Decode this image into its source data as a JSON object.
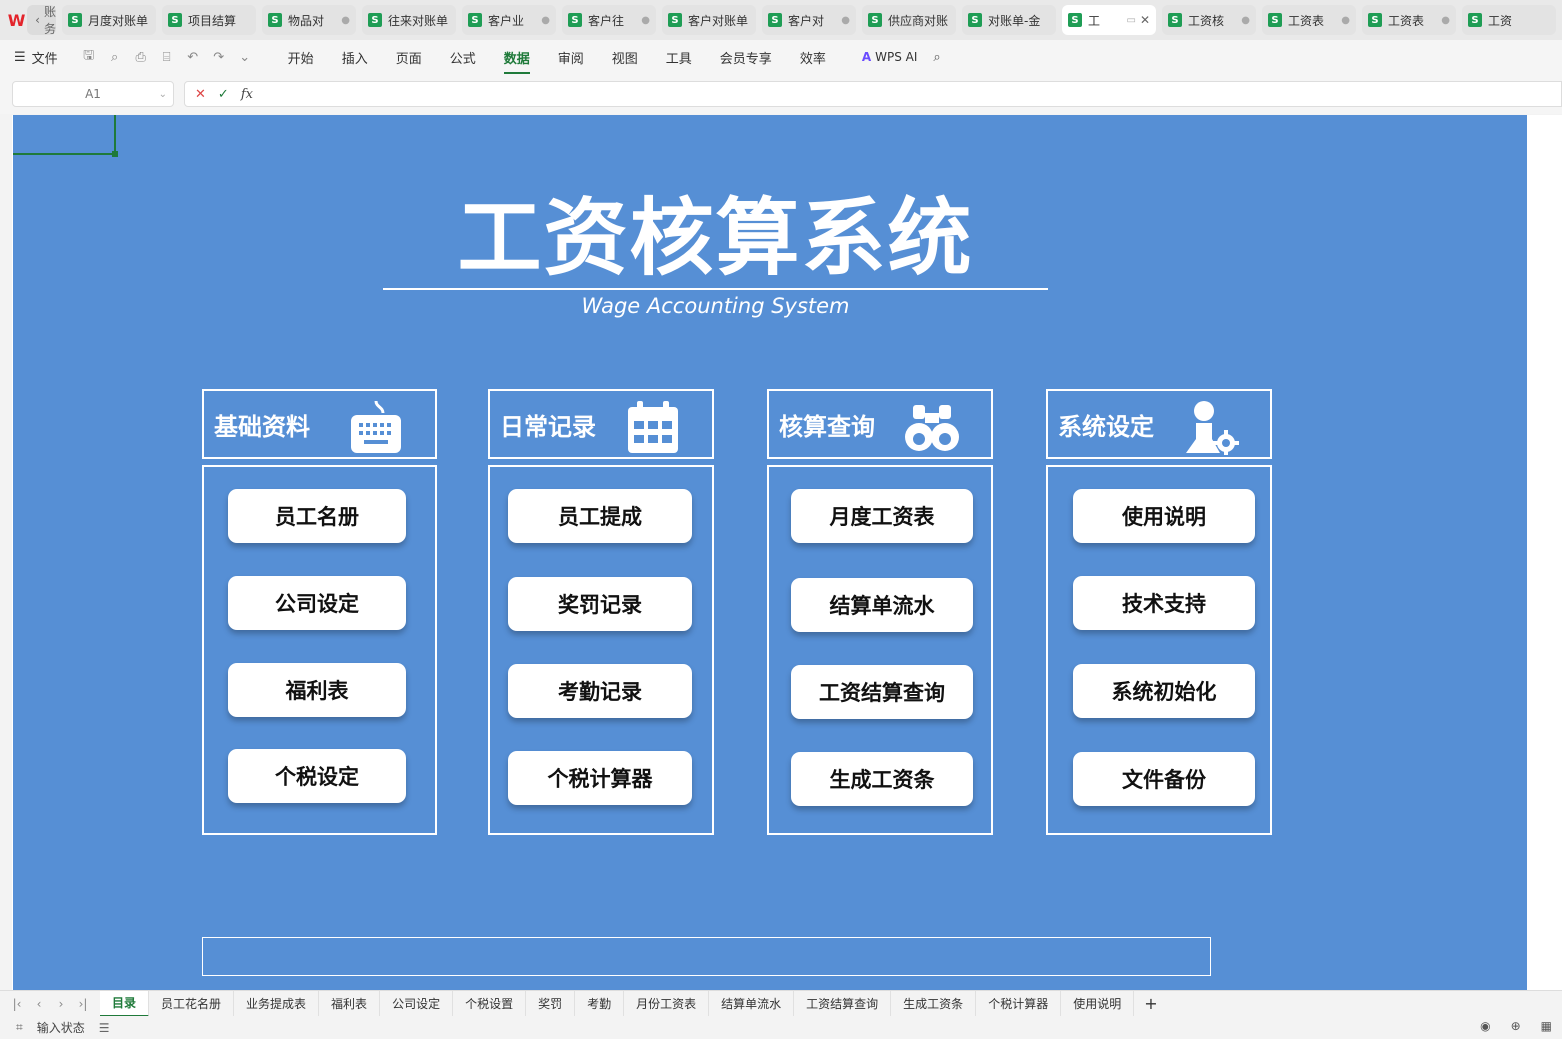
{
  "doc_tabs": [
    {
      "label": "账务",
      "icon": "back",
      "short": true
    },
    {
      "label": "月度对账单"
    },
    {
      "label": "项目结算"
    },
    {
      "label": "物品对",
      "dot": true
    },
    {
      "label": "往来对账单"
    },
    {
      "label": "客户业",
      "dot": true
    },
    {
      "label": "客户往",
      "dot": true
    },
    {
      "label": "客户对账单"
    },
    {
      "label": "客户对",
      "dot": true
    },
    {
      "label": "供应商对账"
    },
    {
      "label": "对账单-金"
    },
    {
      "label": "工",
      "active": true
    },
    {
      "label": "工资核",
      "dot": true
    },
    {
      "label": "工资表",
      "dot": true
    },
    {
      "label": "工资表",
      "dot": true
    },
    {
      "label": "工资"
    }
  ],
  "menubar": {
    "file": "文件",
    "items": [
      "开始",
      "插入",
      "页面",
      "公式",
      "数据",
      "审阅",
      "视图",
      "工具",
      "会员专享",
      "效率"
    ],
    "active": "数据",
    "wps_ai": "WPS AI"
  },
  "formulabar": {
    "cell_ref": "A1",
    "fx": "fx"
  },
  "title": {
    "main": "工资核算系统",
    "sub": "Wage Accounting System"
  },
  "panels": [
    {
      "title": "基础资料",
      "icon": "keyboard-icon",
      "buttons": [
        "员工名册",
        "公司设定",
        "福利表",
        "个税设定"
      ]
    },
    {
      "title": "日常记录",
      "icon": "calendar-icon",
      "buttons": [
        "员工提成",
        "奖罚记录",
        "考勤记录",
        "个税计算器"
      ]
    },
    {
      "title": "核算查询",
      "icon": "binoculars-icon",
      "buttons": [
        "月度工资表",
        "结算单流水",
        "工资结算查询",
        "生成工资条"
      ]
    },
    {
      "title": "系统设定",
      "icon": "user-gear-icon",
      "buttons": [
        "使用说明",
        "技术支持",
        "系统初始化",
        "文件备份"
      ]
    }
  ],
  "sheet_tabs": [
    "目录",
    "员工花名册",
    "业务提成表",
    "福利表",
    "公司设定",
    "个税设置",
    "奖罚",
    "考勤",
    "月份工资表",
    "结算单流水",
    "工资结算查询",
    "生成工资条",
    "个税计算器",
    "使用说明"
  ],
  "active_sheet": "目录",
  "statusbar": {
    "input_state": "输入状态"
  },
  "colors": {
    "canvas": "#568fd5",
    "accent": "#1f7a3a"
  }
}
